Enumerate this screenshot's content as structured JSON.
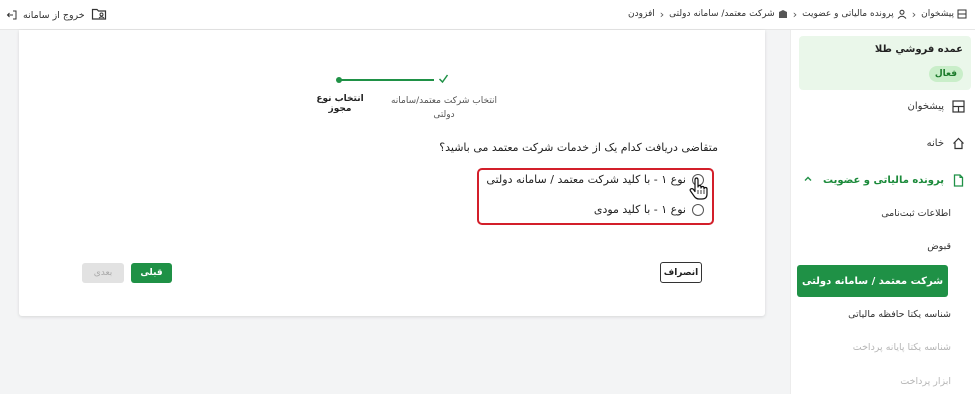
{
  "topbar": {
    "exit_label": "خروج از سامانه",
    "breadcrumb": [
      {
        "label": "پیشخوان",
        "icon": "dashboard-icon"
      },
      {
        "label": "پرونده مالیاتی و عضویت",
        "icon": "user-icon"
      },
      {
        "label": "شرکت معتمد/ سامانه دولتی",
        "icon": "building-icon"
      },
      {
        "label": "افزودن",
        "icon": ""
      }
    ]
  },
  "sidebar": {
    "company_name": "عمده فروشي طلا",
    "status": "فعال",
    "items": [
      {
        "label": "پیشخوان",
        "icon": "dashboard-icon"
      },
      {
        "label": "خانه",
        "icon": "home-icon"
      },
      {
        "label": "پرونده مالیاتی و عضویت",
        "icon": "file-icon"
      }
    ],
    "sub_items": [
      {
        "label": "اطلاعات ثبت‌نامی"
      },
      {
        "label": "قبوض"
      },
      {
        "label": "شرکت معتمد / سامانه دولتی"
      },
      {
        "label": "شناسه یکتا حافظه مالیاتی"
      },
      {
        "label": "شناسه یکتا پایانه پرداخت"
      },
      {
        "label": "ابزار پرداخت"
      }
    ]
  },
  "stepper": {
    "step1_label": "انتخاب نوع مجوز",
    "step2_label": "انتخاب شرکت معتمد/سامانه دولتی"
  },
  "form": {
    "question": "متقاضی دریافت کدام یک از خدمات شرکت معتمد می باشید؟",
    "options": [
      {
        "label": "نوع ۱ - با کلید شرکت معتمد / سامانه دولتی"
      },
      {
        "label": "نوع ۱ - با کلید مودی"
      }
    ]
  },
  "buttons": {
    "cancel": "انصراف",
    "prev": "قبلی",
    "next": "بعدی"
  },
  "colors": {
    "accent": "#1f9146",
    "highlight": "#d31f2a"
  }
}
